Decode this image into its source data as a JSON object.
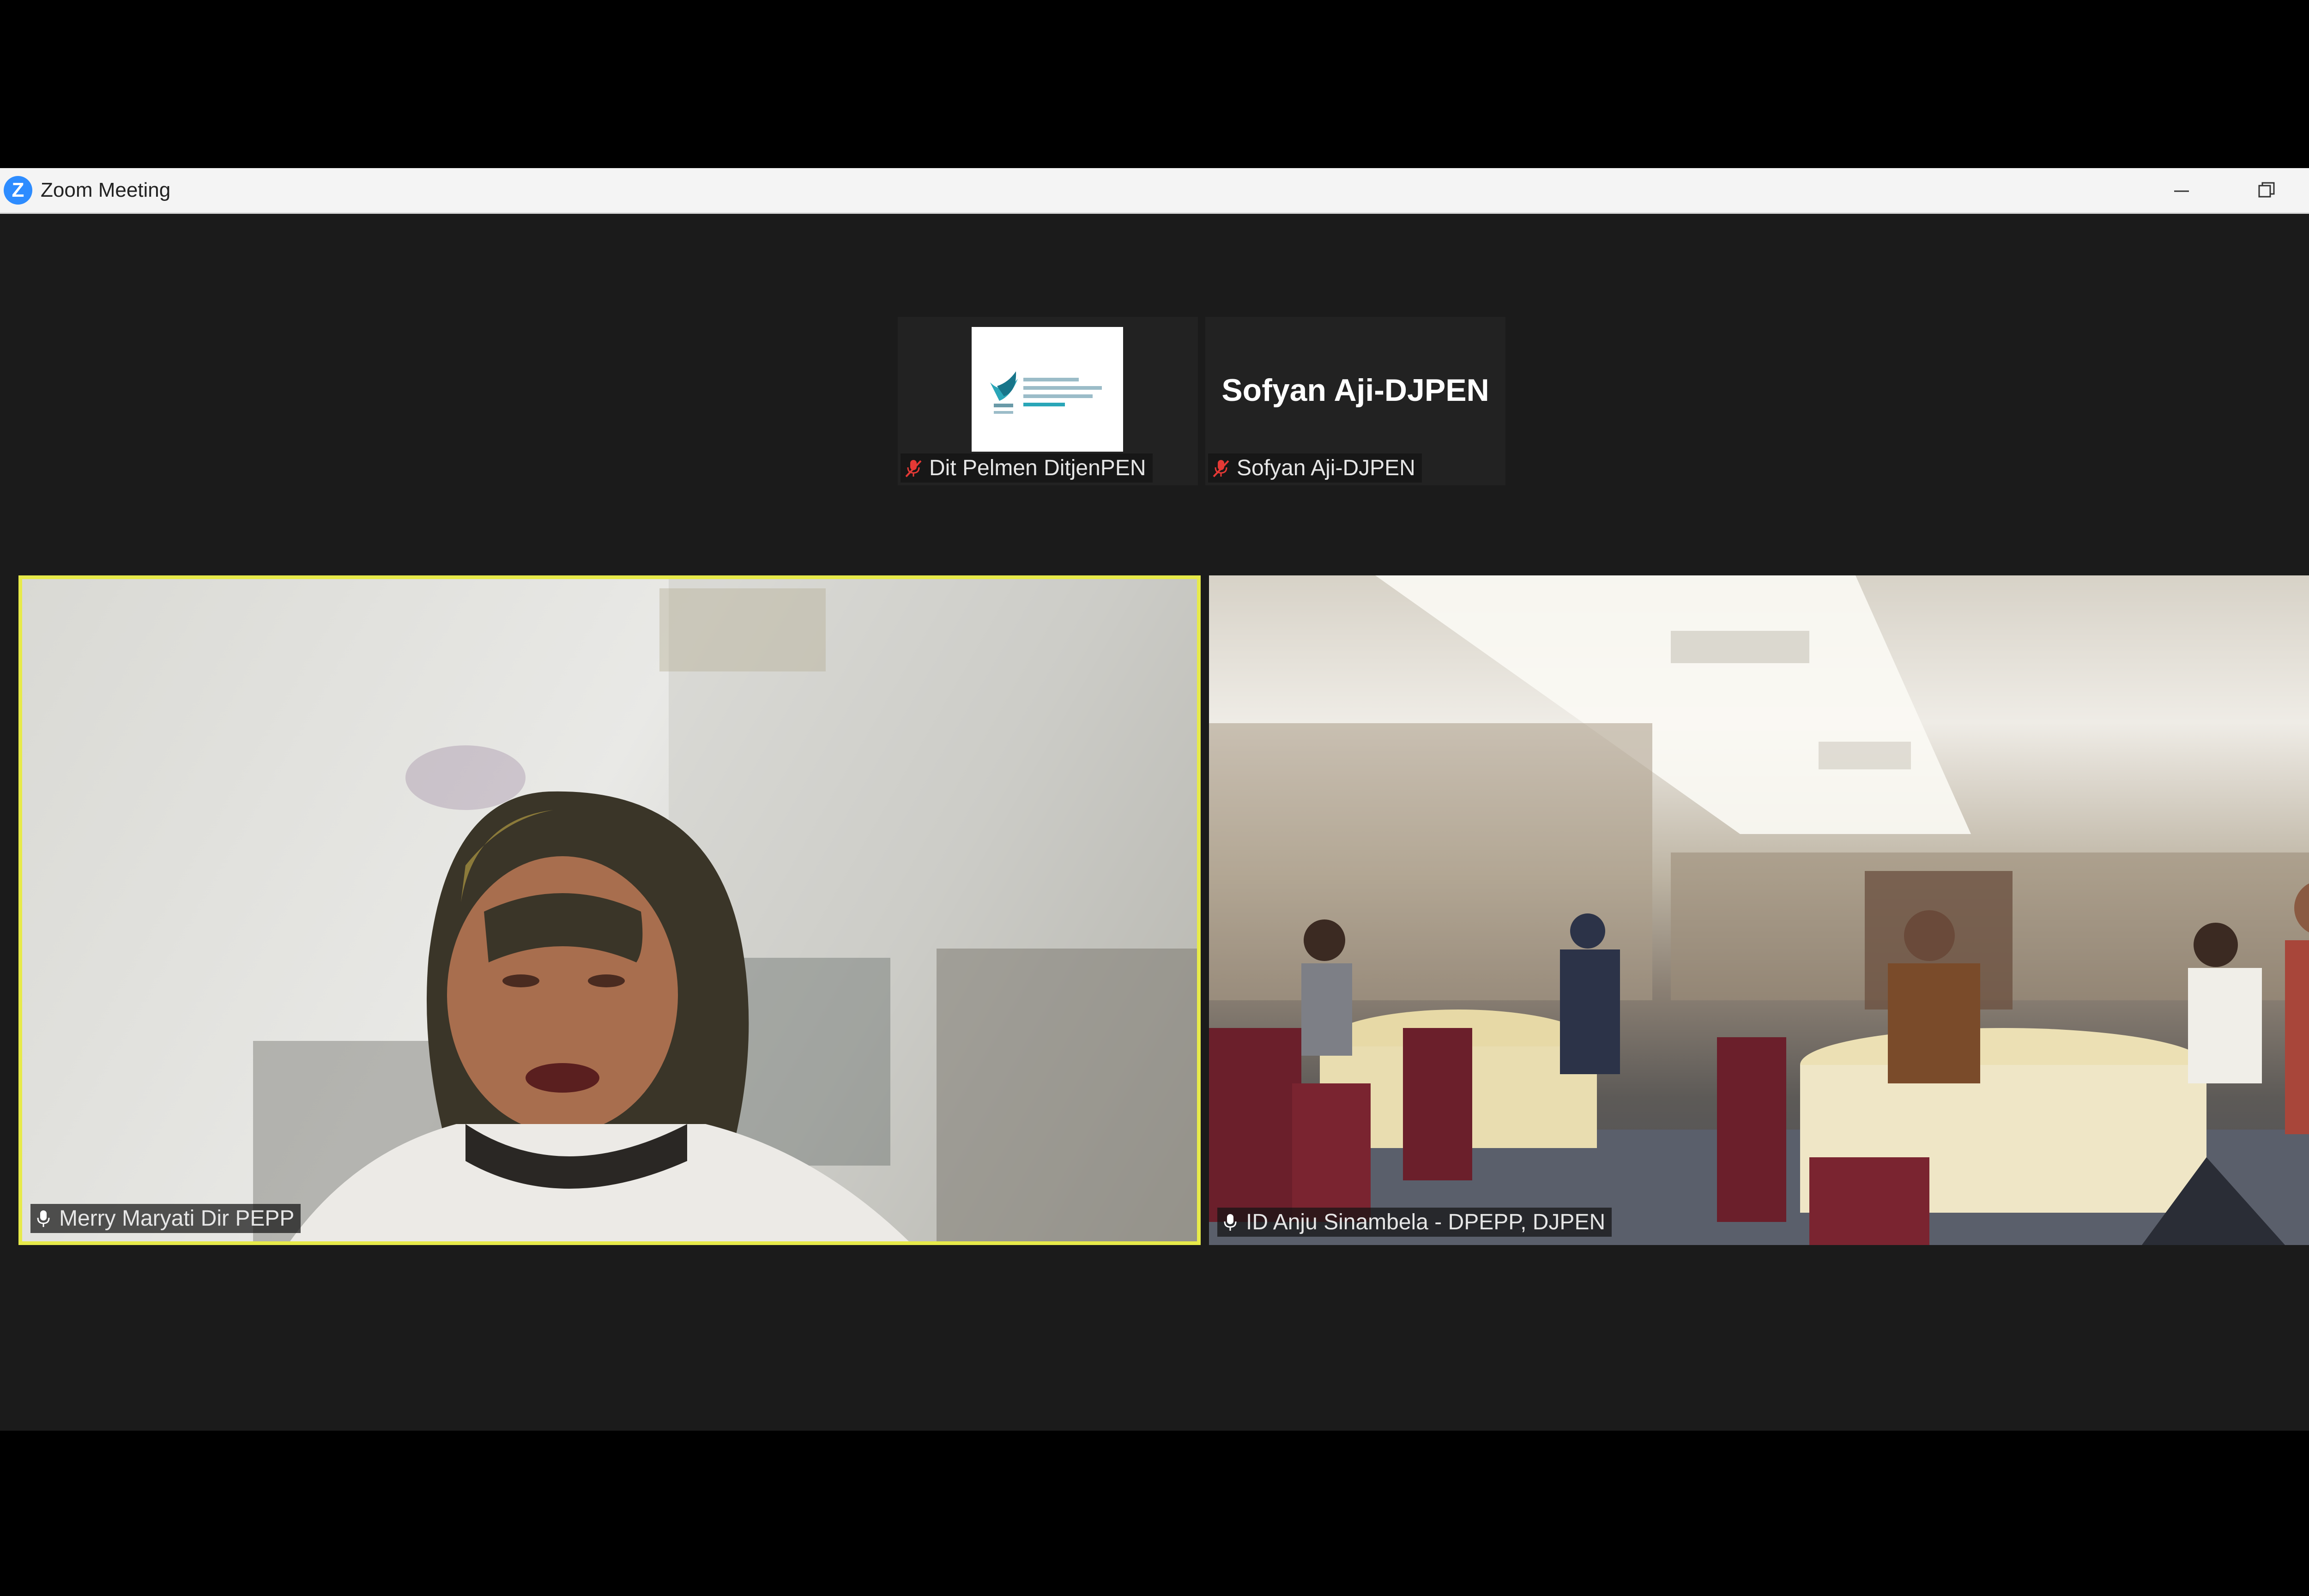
{
  "window": {
    "title": "Zoom Meeting",
    "logo_letter": "Z"
  },
  "window_controls": {
    "minimize_icon": "minimize-icon",
    "restore_icon": "restore-icon",
    "close_icon": "close-icon"
  },
  "thumbnails": [
    {
      "name": "Dit Pelmen DitjenPEN",
      "muted": true,
      "video": "organization-logo"
    },
    {
      "name": "Sofyan Aji-DJPEN",
      "display_name": "Sofyan Aji-DJPEN",
      "muted": true,
      "video": "off"
    }
  ],
  "gallery": [
    {
      "name": "Merry Maryati Dir PEPP",
      "muted": false,
      "active_speaker": true
    },
    {
      "name": "ID Anju Sinambela - DPEPP, DJPEN",
      "muted": false,
      "active_speaker": false
    }
  ],
  "colors": {
    "active_speaker_border": "#e7ea4a",
    "muted_mic": "#e53935",
    "zoom_blue": "#2d8cff",
    "window_bg": "#1b1b1b"
  }
}
